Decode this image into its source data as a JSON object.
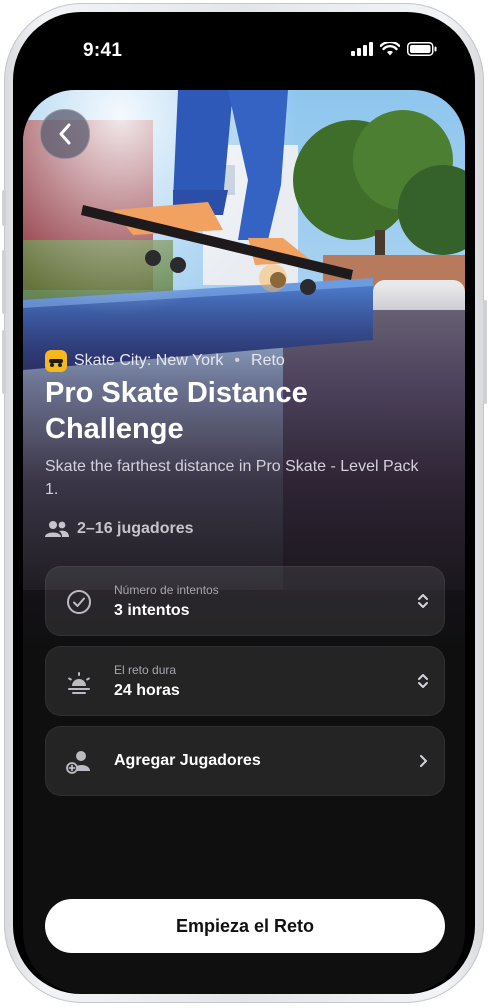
{
  "status_bar": {
    "time": "9:41"
  },
  "game": {
    "name": "Skate City: New York",
    "separator": "•",
    "type": "Reto"
  },
  "challenge": {
    "title": "Pro Skate Distance Challenge",
    "description": "Skate the farthest distance in Pro Skate - Level Pack 1.",
    "players": "2–16 jugadores"
  },
  "options": [
    {
      "label": "Número de intentos",
      "value": "3 intentos",
      "icon": "checkmark-circle-icon"
    },
    {
      "label": "El reto dura",
      "value": "24 horas",
      "icon": "sunrise-icon"
    },
    {
      "label": "",
      "value": "Agregar Jugadores",
      "icon": "add-person-icon"
    }
  ],
  "actions": {
    "start_label": "Empieza el Reto"
  },
  "colors": {
    "background": "#0f0f10",
    "button": "#ffffff",
    "game_icon": "#f6b81c"
  }
}
